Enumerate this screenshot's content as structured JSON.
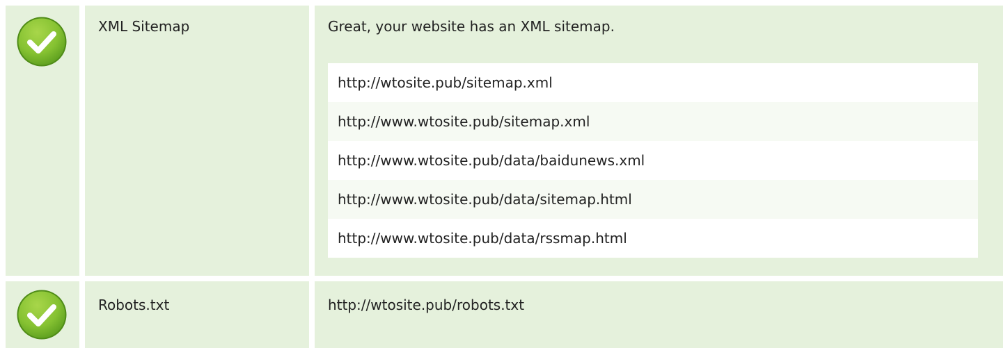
{
  "checks": [
    {
      "status_icon": "check-circle-icon",
      "name": "XML Sitemap",
      "message": "Great, your website has an XML sitemap.",
      "urls": [
        "http://wtosite.pub/sitemap.xml",
        "http://www.wtosite.pub/sitemap.xml",
        "http://www.wtosite.pub/data/baidunews.xml",
        "http://www.wtosite.pub/data/sitemap.html",
        "http://www.wtosite.pub/data/rssmap.html"
      ]
    },
    {
      "status_icon": "check-circle-icon",
      "name": "Robots.txt",
      "message": "http://wtosite.pub/robots.txt"
    }
  ],
  "colors": {
    "row_background": "#e5f1dc",
    "check_green_light": "#93cb3c",
    "check_green_dark": "#5c9e1e",
    "check_mark": "#ffffff"
  }
}
